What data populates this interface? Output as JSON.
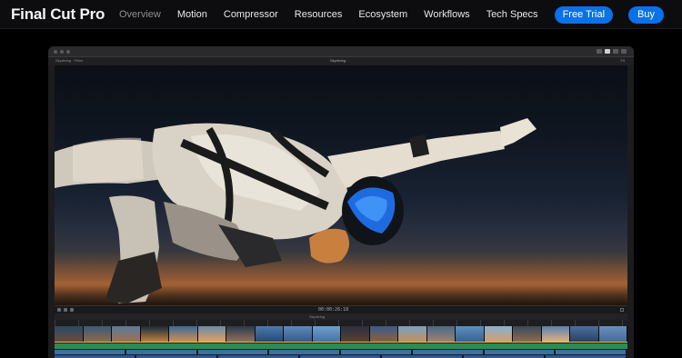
{
  "nav": {
    "brand": "Final Cut Pro",
    "links": [
      "Overview",
      "Motion",
      "Compressor",
      "Resources",
      "Ecosystem",
      "Workflows",
      "Tech Specs"
    ],
    "active": "Overview",
    "free_trial": "Free Trial",
    "buy": "Buy"
  },
  "app": {
    "library": "Skydiving · Films",
    "project_title": "Skydiving",
    "zoom": "Fit",
    "timecode": "00:00:26:18"
  },
  "colors": {
    "accent": "#0a71e8",
    "clip_green": "#2e8b57",
    "clip_blue": "#3a6fa8",
    "background": "#000000"
  }
}
